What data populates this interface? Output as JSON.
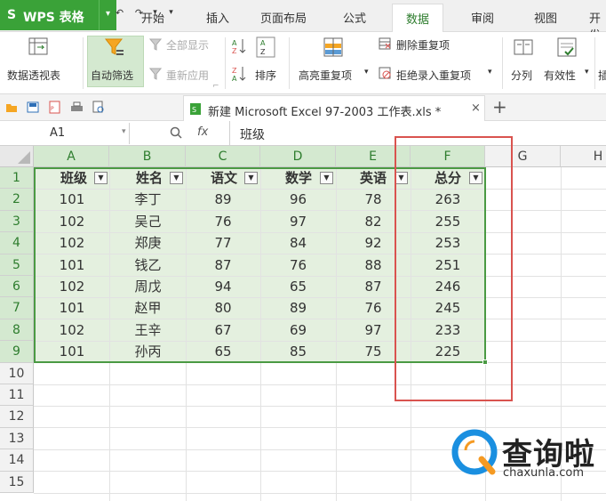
{
  "app": {
    "logo": "S",
    "title": "WPS 表格",
    "arrow": "▾"
  },
  "menu": [
    "开始",
    "插入",
    "页面布局",
    "公式",
    "数据",
    "审阅",
    "视图",
    "开发"
  ],
  "ribbon": {
    "pivot": "数据透视表",
    "autofilter": "自动筛选",
    "showall": "全部显示",
    "reapply": "重新应用",
    "sort": "排序",
    "highlight_dup": "高亮重复项",
    "remove_dup": "删除重复项",
    "reject_dup": "拒绝录入重复项",
    "split": "分列",
    "validity": "有效性",
    "cut": "插"
  },
  "doc_tab": {
    "name": "新建 Microsoft Excel 97-2003 工作表.xls *",
    "close": "×",
    "add": "+"
  },
  "formula_bar": {
    "cell_ref": "A1",
    "fx": "fx",
    "value": "班级"
  },
  "columns": [
    "A",
    "B",
    "C",
    "D",
    "E",
    "F",
    "G",
    "H"
  ],
  "rows": [
    "1",
    "2",
    "3",
    "4",
    "5",
    "6",
    "7",
    "8",
    "9",
    "10",
    "11",
    "12",
    "13",
    "14",
    "15"
  ],
  "table": {
    "headers": [
      "班级",
      "姓名",
      "语文",
      "数学",
      "英语",
      "总分"
    ],
    "data": [
      [
        "101",
        "李丁",
        "89",
        "96",
        "78",
        "263"
      ],
      [
        "102",
        "吴己",
        "76",
        "97",
        "82",
        "255"
      ],
      [
        "102",
        "郑庚",
        "77",
        "84",
        "92",
        "253"
      ],
      [
        "101",
        "钱乙",
        "87",
        "76",
        "88",
        "251"
      ],
      [
        "102",
        "周戊",
        "94",
        "65",
        "87",
        "246"
      ],
      [
        "101",
        "赵甲",
        "80",
        "89",
        "76",
        "245"
      ],
      [
        "102",
        "王辛",
        "67",
        "69",
        "97",
        "233"
      ],
      [
        "101",
        "孙丙",
        "65",
        "85",
        "75",
        "225"
      ]
    ]
  },
  "watermark": {
    "brand": "查询啦",
    "url": "chaxunla.com"
  },
  "colors": {
    "accent": "#3aa238",
    "selection": "#d4e9d0",
    "highlight_box": "#d9534f",
    "watermark_blue": "#1a8fe0",
    "watermark_orange": "#f59a23"
  }
}
